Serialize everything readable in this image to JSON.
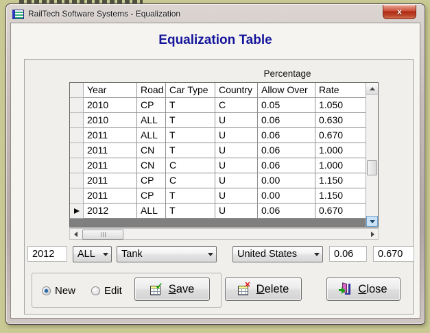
{
  "window": {
    "title": "RailTech Software Systems - Equalization",
    "close_button": "x"
  },
  "heading": "Equalization Table",
  "grid": {
    "group_header": "Percentage",
    "columns": [
      "Year",
      "Road",
      "Car Type",
      "Country",
      "Allow Over",
      "Rate"
    ],
    "rows": [
      [
        "2010",
        "CP",
        "T",
        "C",
        "0.05",
        "1.050"
      ],
      [
        "2010",
        "ALL",
        "T",
        "U",
        "0.06",
        "0.630"
      ],
      [
        "2011",
        "ALL",
        "T",
        "U",
        "0.06",
        "0.670"
      ],
      [
        "2011",
        "CN",
        "T",
        "U",
        "0.06",
        "1.000"
      ],
      [
        "2011",
        "CN",
        "C",
        "U",
        "0.06",
        "1.000"
      ],
      [
        "2011",
        "CP",
        "C",
        "U",
        "0.00",
        "1.150"
      ],
      [
        "2011",
        "CP",
        "T",
        "U",
        "0.00",
        "1.150"
      ],
      [
        "2012",
        "ALL",
        "T",
        "U",
        "0.06",
        "0.670"
      ]
    ],
    "current_row_index": 7
  },
  "form": {
    "year_value": "2012",
    "road_value": "ALL",
    "car_type_value": "Tank",
    "country_value": "United States",
    "allow_over_value": "0.06",
    "rate_value": "0.670"
  },
  "mode": {
    "new_label": "New",
    "edit_label": "Edit",
    "selected": "new"
  },
  "actions": {
    "save_label": "Save",
    "delete_label": "Delete",
    "close_label": "Close"
  },
  "colors": {
    "heading_text": "#15159a",
    "close_button_red": "#b02912",
    "grid_filler_gray": "#7f7f7f",
    "desktop_background": "#c9c994"
  }
}
